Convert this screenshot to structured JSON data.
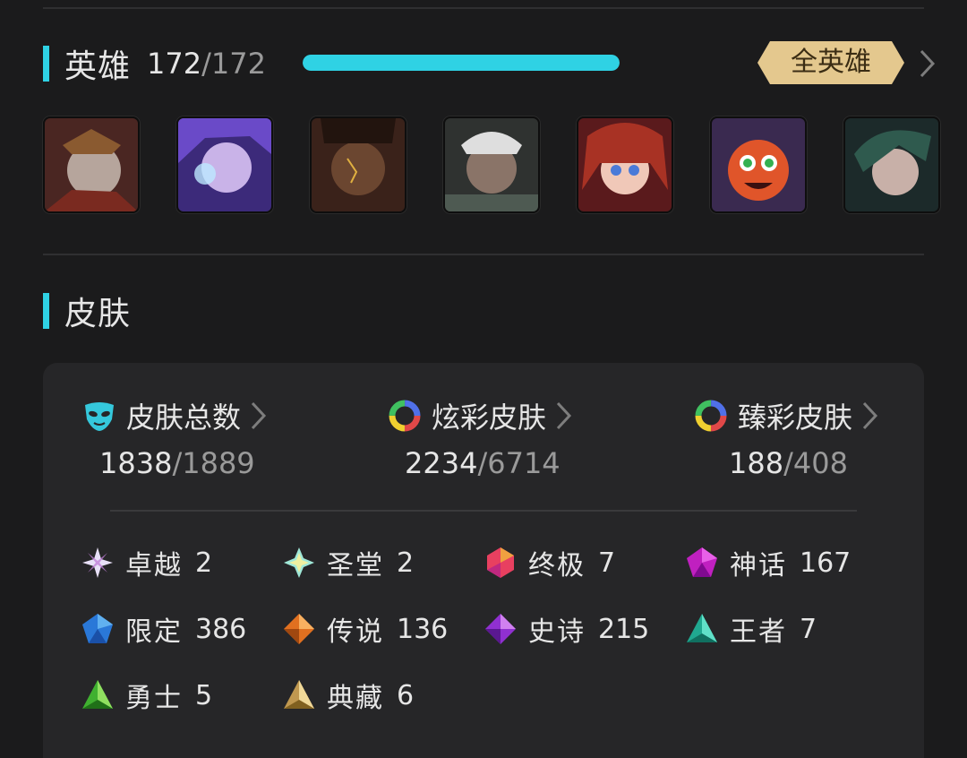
{
  "heroes_section": {
    "title": "英雄",
    "owned": "172",
    "separator": "/",
    "total": "172",
    "progress": 1.0,
    "all_button": "全英雄",
    "accent_color": "#2fd2e4",
    "portraits": [
      {
        "icon": "hero-portrait-1"
      },
      {
        "icon": "hero-portrait-2"
      },
      {
        "icon": "hero-portrait-3"
      },
      {
        "icon": "hero-portrait-4"
      },
      {
        "icon": "hero-portrait-5"
      },
      {
        "icon": "hero-portrait-6"
      },
      {
        "icon": "hero-portrait-7"
      }
    ]
  },
  "skins_section": {
    "title": "皮肤",
    "stats": [
      {
        "icon": "mask-icon",
        "label": "皮肤总数",
        "owned": "1838",
        "separator": "/",
        "total": "1889"
      },
      {
        "icon": "color-ring-icon",
        "label": "炫彩皮肤",
        "owned": "2234",
        "separator": "/",
        "total": "6714"
      },
      {
        "icon": "color-ring-icon",
        "label": "臻彩皮肤",
        "owned": "188",
        "separator": "/",
        "total": "408"
      }
    ],
    "rarities": [
      {
        "icon": "transcendent-gem-icon",
        "name": "卓越",
        "count": "2"
      },
      {
        "icon": "hall-gem-icon",
        "name": "圣堂",
        "count": "2"
      },
      {
        "icon": "ultimate-gem-icon",
        "name": "终极",
        "count": "7"
      },
      {
        "icon": "mythic-gem-icon",
        "name": "神话",
        "count": "167"
      },
      {
        "icon": "limited-gem-icon",
        "name": "限定",
        "count": "386"
      },
      {
        "icon": "legendary-gem-icon",
        "name": "传说",
        "count": "136"
      },
      {
        "icon": "epic-gem-icon",
        "name": "史诗",
        "count": "215"
      },
      {
        "icon": "royal-gem-icon",
        "name": "王者",
        "count": "7"
      },
      {
        "icon": "warrior-gem-icon",
        "name": "勇士",
        "count": "5"
      },
      {
        "icon": "collector-gem-icon",
        "name": "典藏",
        "count": "6"
      }
    ]
  }
}
